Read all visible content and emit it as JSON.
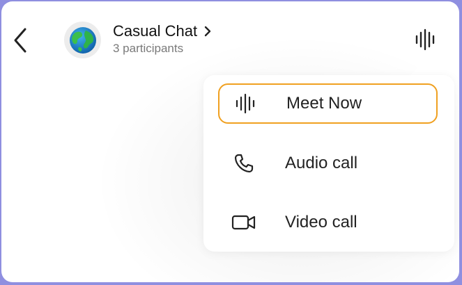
{
  "header": {
    "back_icon": "chevron-left-icon",
    "avatar_icon": "globe-icon",
    "chat_title": "Casual Chat",
    "title_chevron": "›",
    "participants": "3 participants",
    "meet_icon": "audio-wave-icon"
  },
  "menu": {
    "items": [
      {
        "label": "Meet Now",
        "icon": "audio-wave-icon",
        "highlighted": true
      },
      {
        "label": "Audio call",
        "icon": "phone-icon"
      },
      {
        "label": "Video call",
        "icon": "video-camera-icon"
      }
    ]
  },
  "colors": {
    "highlight_border": "#f0a020",
    "frame_border": "#8f8fe0",
    "globe_ocean": "#1e8fd6",
    "globe_land": "#3cbf4a"
  }
}
